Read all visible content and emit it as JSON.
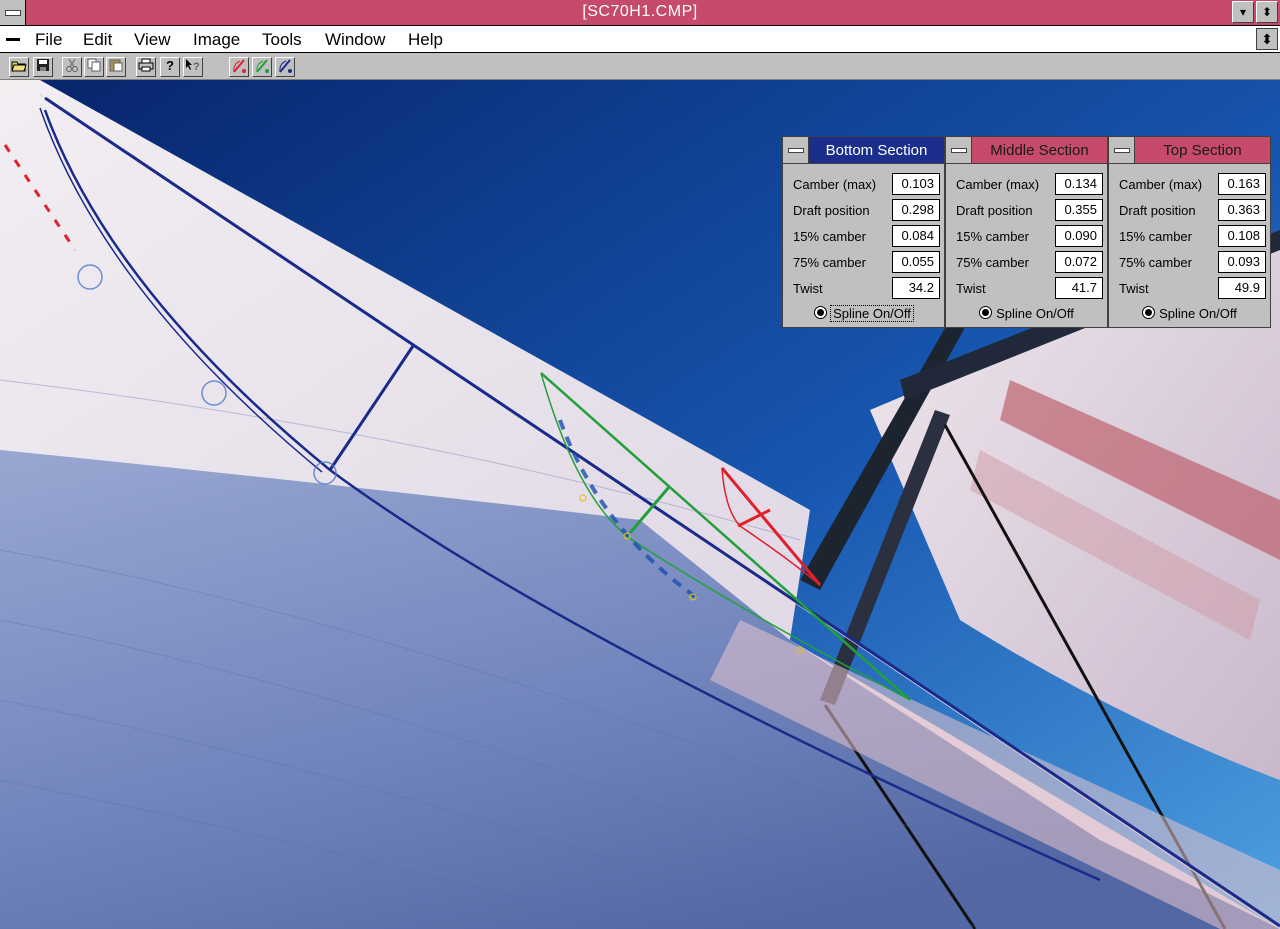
{
  "window": {
    "title": "[SC70H1.CMP]",
    "minimize_glyph": "▾",
    "restore_glyph": "⬍"
  },
  "menu": {
    "items": [
      "File",
      "Edit",
      "View",
      "Image",
      "Tools",
      "Window",
      "Help"
    ],
    "restore_glyph": "⬍"
  },
  "toolbar": {
    "buttons": [
      "open-icon",
      "save-icon",
      "cut-icon",
      "copy-icon",
      "paste-icon",
      "print-icon",
      "help-icon",
      "context-help-icon",
      "red-curve-tool-icon",
      "green-curve-tool-icon",
      "blue-curve-tool-icon"
    ]
  },
  "panels": [
    {
      "title": "Bottom Section",
      "title_bg": "#1a2f8c",
      "title_fg": "#ffffff",
      "rows": [
        {
          "label": "Camber (max)",
          "value": "0.103"
        },
        {
          "label": "Draft position",
          "value": "0.298"
        },
        {
          "label": "15% camber",
          "value": "0.084"
        },
        {
          "label": "75% camber",
          "value": "0.055"
        },
        {
          "label": "Twist",
          "value": "34.2"
        }
      ],
      "spline_label": "Spline On/Off"
    },
    {
      "title": "Middle Section",
      "title_bg": "#c64a6a",
      "title_fg": "#1a1a1a",
      "rows": [
        {
          "label": "Camber (max)",
          "value": "0.134"
        },
        {
          "label": "Draft position",
          "value": "0.355"
        },
        {
          "label": "15% camber",
          "value": "0.090"
        },
        {
          "label": "75% camber",
          "value": "0.072"
        },
        {
          "label": "Twist",
          "value": "41.7"
        }
      ],
      "spline_label": "Spline On/Off"
    },
    {
      "title": "Top Section",
      "title_bg": "#c64a6a",
      "title_fg": "#1a1a1a",
      "rows": [
        {
          "label": "Camber (max)",
          "value": "0.163"
        },
        {
          "label": "Draft position",
          "value": "0.363"
        },
        {
          "label": "15% camber",
          "value": "0.108"
        },
        {
          "label": "75% camber",
          "value": "0.093"
        },
        {
          "label": "Twist",
          "value": "49.9"
        }
      ],
      "spline_label": "Spline On/Off"
    }
  ],
  "colors": {
    "sky": "#0f3f8c",
    "sail": "#e8e6ee",
    "bottom_section": "#1a2a8a",
    "middle_section": "#22a03a",
    "top_section": "#e0202a"
  }
}
